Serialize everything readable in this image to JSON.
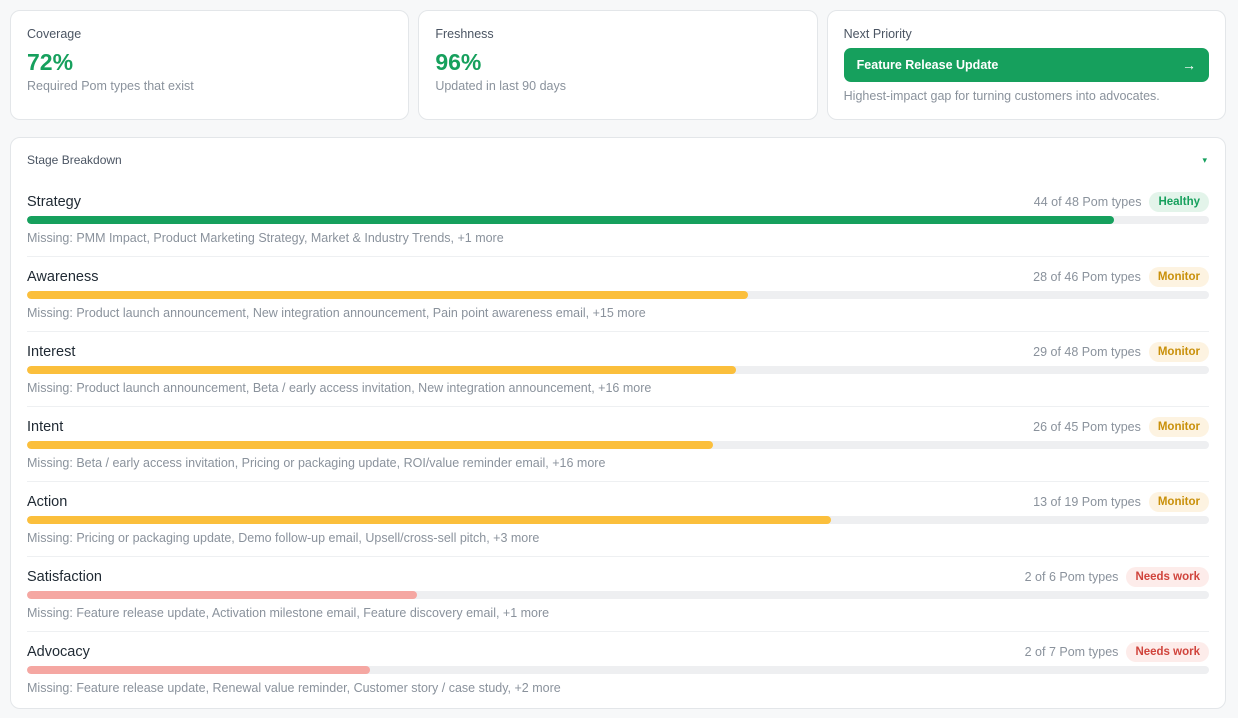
{
  "metrics": {
    "coverage": {
      "title": "Coverage",
      "value": "72%",
      "subtitle": "Required Pom types that exist"
    },
    "freshness": {
      "title": "Freshness",
      "value": "96%",
      "subtitle": "Updated in last 90 days"
    },
    "next_priority": {
      "title": "Next Priority",
      "button_label": "Feature Release Update",
      "button_icon": "arrow-right-icon",
      "subtitle": "Highest-impact gap for turning customers into advocates."
    }
  },
  "breakdown": {
    "title": "Stage Breakdown",
    "toggle_icon": "▾",
    "stages": [
      {
        "name": "Strategy",
        "count": "44 of 48 Pom types",
        "status": "Healthy",
        "status_class": "healthy",
        "progress": 0.92,
        "bar_color": "#16a05d",
        "missing": "Missing: PMM Impact, Product Marketing Strategy, Market & Industry Trends, +1 more"
      },
      {
        "name": "Awareness",
        "count": "28 of 46 Pom types",
        "status": "Monitor",
        "status_class": "monitor",
        "progress": 0.61,
        "bar_color": "#fbbf3c",
        "missing": "Missing: Product launch announcement, New integration announcement, Pain point awareness email, +15 more"
      },
      {
        "name": "Interest",
        "count": "29 of 48 Pom types",
        "status": "Monitor",
        "status_class": "monitor",
        "progress": 0.6,
        "bar_color": "#fbbf3c",
        "missing": "Missing: Product launch announcement, Beta / early access invitation, New integration announcement, +16 more"
      },
      {
        "name": "Intent",
        "count": "26 of 45 Pom types",
        "status": "Monitor",
        "status_class": "monitor",
        "progress": 0.58,
        "bar_color": "#fbbf3c",
        "missing": "Missing: Beta / early access invitation, Pricing or packaging update, ROI/value reminder email, +16 more"
      },
      {
        "name": "Action",
        "count": "13 of 19 Pom types",
        "status": "Monitor",
        "status_class": "monitor",
        "progress": 0.68,
        "bar_color": "#fbbf3c",
        "missing": "Missing: Pricing or packaging update, Demo follow-up email, Upsell/cross-sell pitch, +3 more"
      },
      {
        "name": "Satisfaction",
        "count": "2 of 6 Pom types",
        "status": "Needs work",
        "status_class": "needs",
        "progress": 0.33,
        "bar_color": "#f5a7a2",
        "missing": "Missing: Feature release update, Activation milestone email, Feature discovery email, +1 more"
      },
      {
        "name": "Advocacy",
        "count": "2 of 7 Pom types",
        "status": "Needs work",
        "status_class": "needs",
        "progress": 0.29,
        "bar_color": "#f5a7a2",
        "missing": "Missing: Feature release update, Renewal value reminder, Customer story / case study, +2 more"
      }
    ]
  }
}
